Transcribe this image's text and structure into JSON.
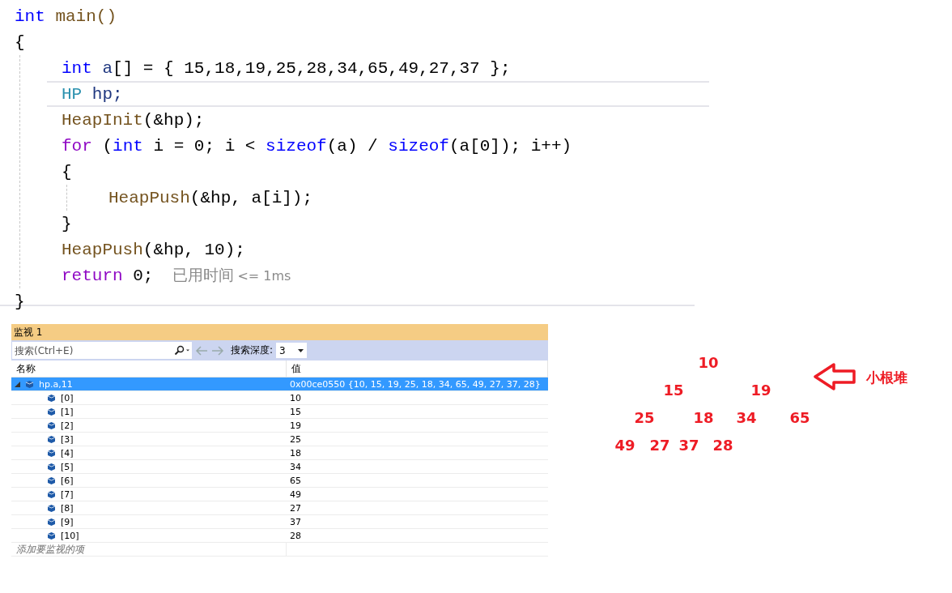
{
  "code": {
    "lines": [
      {
        "tokens": [
          {
            "text": "int",
            "kind": "keyword"
          },
          {
            "text": " main()",
            "kind": "func"
          }
        ]
      },
      {
        "tokens": [
          {
            "text": "{",
            "kind": "plain"
          }
        ],
        "children": [
          {
            "tokens": [
              {
                "text": "int",
                "kind": "keyword"
              },
              {
                "text": " a",
                "kind": "var"
              },
              {
                "text": "[] = { 15,18,19,25,28,34,65,49,27,37 };",
                "kind": "plain"
              }
            ]
          },
          {
            "current": true,
            "tokens": [
              {
                "text": "HP",
                "kind": "type"
              },
              {
                "text": " hp;",
                "kind": "var"
              }
            ]
          },
          {
            "tokens": [
              {
                "text": "HeapInit",
                "kind": "func"
              },
              {
                "text": "(&hp);",
                "kind": "plain"
              }
            ]
          },
          {
            "tokens": [
              {
                "text": "for",
                "kind": "control"
              },
              {
                "text": " (",
                "kind": "plain"
              },
              {
                "text": "int",
                "kind": "keyword"
              },
              {
                "text": " i = 0; i < ",
                "kind": "plain"
              },
              {
                "text": "sizeof",
                "kind": "keyword"
              },
              {
                "text": "(a) / ",
                "kind": "plain"
              },
              {
                "text": "sizeof",
                "kind": "keyword"
              },
              {
                "text": "(a[0]); i++)",
                "kind": "plain"
              }
            ]
          },
          {
            "tokens": [
              {
                "text": "{",
                "kind": "plain"
              }
            ],
            "children": [
              {
                "tokens": [
                  {
                    "text": "HeapPush",
                    "kind": "func"
                  },
                  {
                    "text": "(&hp, a[i]);",
                    "kind": "plain"
                  }
                ]
              }
            ]
          },
          {
            "tokens": [
              {
                "text": "}",
                "kind": "plain"
              }
            ]
          },
          {
            "tokens": [
              {
                "text": "HeapPush",
                "kind": "func"
              },
              {
                "text": "(&hp, 10);",
                "kind": "plain"
              }
            ]
          },
          {
            "tokens": [
              {
                "text": "return",
                "kind": "control"
              },
              {
                "text": " 0;",
                "kind": "plain"
              }
            ],
            "hint": "已用时间",
            "hint_detail": "<= 1ms"
          }
        ]
      },
      {
        "tokens": [
          {
            "text": "}",
            "kind": "plain"
          }
        ]
      }
    ]
  },
  "watch": {
    "title": "监视 1",
    "search": {
      "placeholder": "搜索(Ctrl+E)"
    },
    "depth_label": "搜索深度:",
    "depth_value": "3",
    "columns": [
      "名称",
      "值"
    ],
    "rows": [
      {
        "name": "hp.a,11",
        "value": "0x00ce0550 {10, 15, 19, 25, 18, 34, 65, 49, 27, 37, 28}",
        "expanded": true,
        "selected": true,
        "children": [
          {
            "name": "[0]",
            "value": "10",
            "selected": false
          },
          {
            "name": "[1]",
            "value": "15",
            "selected": false
          },
          {
            "name": "[2]",
            "value": "19",
            "selected": false
          },
          {
            "name": "[3]",
            "value": "25",
            "selected": false
          },
          {
            "name": "[4]",
            "value": "18",
            "selected": false
          },
          {
            "name": "[5]",
            "value": "34",
            "selected": false
          },
          {
            "name": "[6]",
            "value": "65",
            "selected": false
          },
          {
            "name": "[7]",
            "value": "49",
            "selected": false
          },
          {
            "name": "[8]",
            "value": "27",
            "selected": false
          },
          {
            "name": "[9]",
            "value": "37",
            "selected": false
          },
          {
            "name": "[10]",
            "value": "28",
            "selected": false
          }
        ]
      }
    ],
    "add_item": "添加要监视的项"
  },
  "heap_note": {
    "levels": [
      [
        "10"
      ],
      [
        "15",
        "19"
      ],
      [
        "25",
        "18",
        "34",
        "65"
      ],
      [
        "49",
        "27",
        "37",
        "28"
      ]
    ],
    "label": "小根堆"
  }
}
